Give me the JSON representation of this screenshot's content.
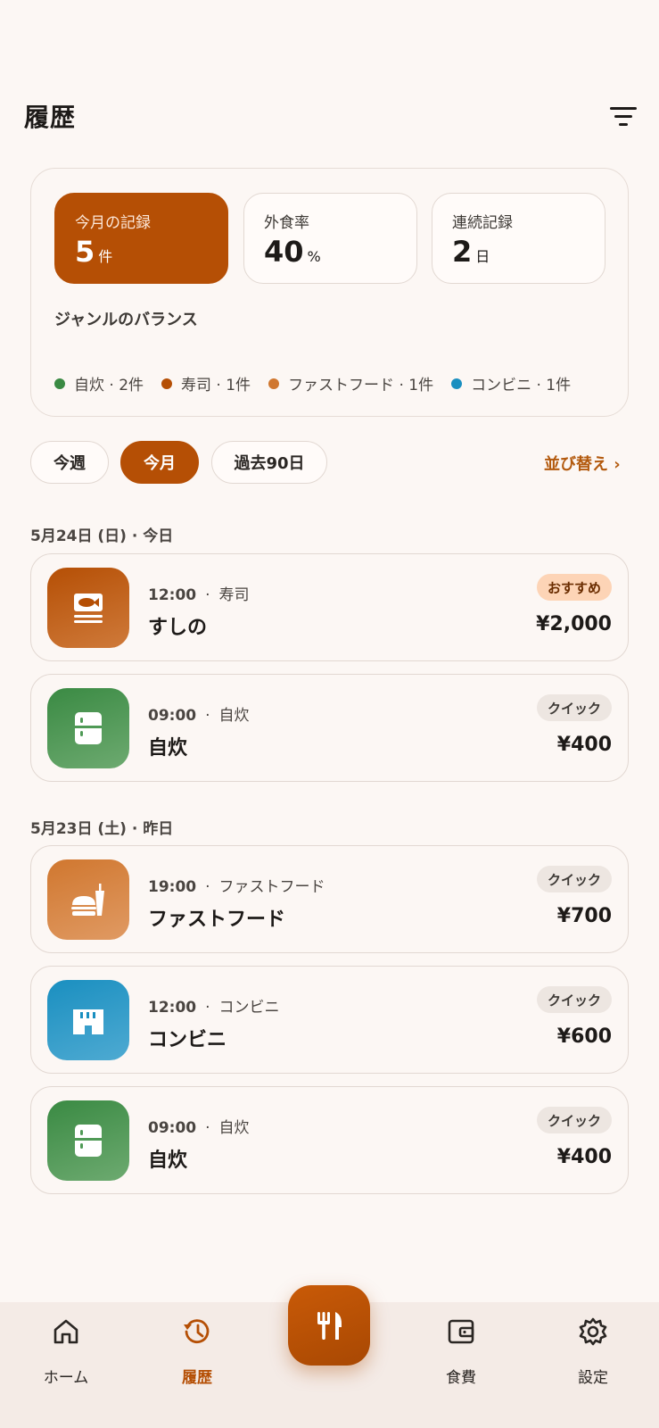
{
  "header": {
    "title": "履歴",
    "filter_icon": "filter-icon"
  },
  "summary": {
    "stats": [
      {
        "label": "今月の記録",
        "value": "5",
        "unit": "件"
      },
      {
        "label": "外食率",
        "value": "40",
        "unit": "%"
      },
      {
        "label": "連続記録",
        "value": "2",
        "unit": "日"
      }
    ],
    "genre_title": "ジャンルのバランス",
    "legend": [
      {
        "label": "自炊 · 2件",
        "color": "#3a8a43"
      },
      {
        "label": "寿司 · 1件",
        "color": "#b54f05"
      },
      {
        "label": "ファストフード · 1件",
        "color": "#d0772f"
      },
      {
        "label": "コンビニ · 1件",
        "color": "#1a8fc0"
      }
    ]
  },
  "period": {
    "chips": [
      "今週",
      "今月",
      "過去90日"
    ],
    "selected": "今月",
    "sort_label": "並び替え ›"
  },
  "groups": [
    {
      "date": "5月24日 (日) · 今日",
      "records": [
        {
          "time": "12:00",
          "sep": "·",
          "genre": "寿司",
          "name": "すしの",
          "badge": "おすすめ",
          "price": "¥2,000",
          "icon": "sushi-icon",
          "color": "#b54f05"
        },
        {
          "time": "09:00",
          "sep": "·",
          "genre": "自炊",
          "name": "自炊",
          "badge": "クイック",
          "price": "¥400",
          "icon": "fridge-icon",
          "color": "#3a8a43"
        }
      ]
    },
    {
      "date": "5月23日 (土) · 昨日",
      "records": [
        {
          "time": "19:00",
          "sep": "·",
          "genre": "ファストフード",
          "name": "ファストフード",
          "badge": "クイック",
          "price": "¥700",
          "icon": "fastfood-icon",
          "color": "#d0772f"
        },
        {
          "time": "12:00",
          "sep": "·",
          "genre": "コンビニ",
          "name": "コンビニ",
          "badge": "クイック",
          "price": "¥600",
          "icon": "convenience-store-icon",
          "color": "#1a8fc0"
        },
        {
          "time": "09:00",
          "sep": "·",
          "genre": "自炊",
          "name": "自炊",
          "badge": "クイック",
          "price": "¥400",
          "icon": "fridge-icon",
          "color": "#3a8a43"
        }
      ]
    }
  ],
  "nav": {
    "items": [
      {
        "label": "ホーム",
        "icon": "home-icon"
      },
      {
        "label": "履歴",
        "icon": "history-icon"
      },
      {
        "label": "食費",
        "icon": "wallet-icon"
      },
      {
        "label": "設定",
        "icon": "gear-icon"
      }
    ],
    "active": "履歴",
    "fab_icon": "fork-knife-icon"
  }
}
